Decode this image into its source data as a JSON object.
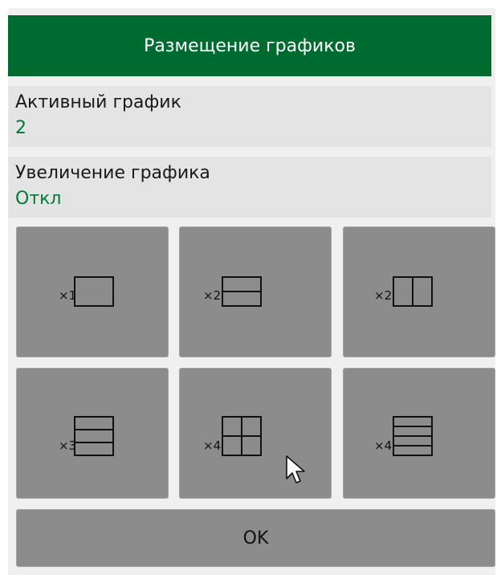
{
  "dialog": {
    "title": "Размещение графиков",
    "active_trace": {
      "label": "Активный график",
      "value": "2"
    },
    "zoom": {
      "label": "Увеличение графика",
      "value": "Откл"
    }
  },
  "layouts": [
    {
      "count_label": "×1",
      "icon": "single-pane-icon"
    },
    {
      "count_label": "×2",
      "icon": "two-rows-icon"
    },
    {
      "count_label": "×2",
      "icon": "two-columns-icon"
    },
    {
      "count_label": "×3",
      "icon": "three-rows-icon"
    },
    {
      "count_label": "×4",
      "icon": "quad-grid-icon"
    },
    {
      "count_label": "×4",
      "icon": "four-rows-icon"
    }
  ],
  "ok_label": "OK",
  "colors": {
    "title_bg": "#006b30",
    "value_text": "#007a35",
    "button_bg": "#8c8c8c"
  }
}
